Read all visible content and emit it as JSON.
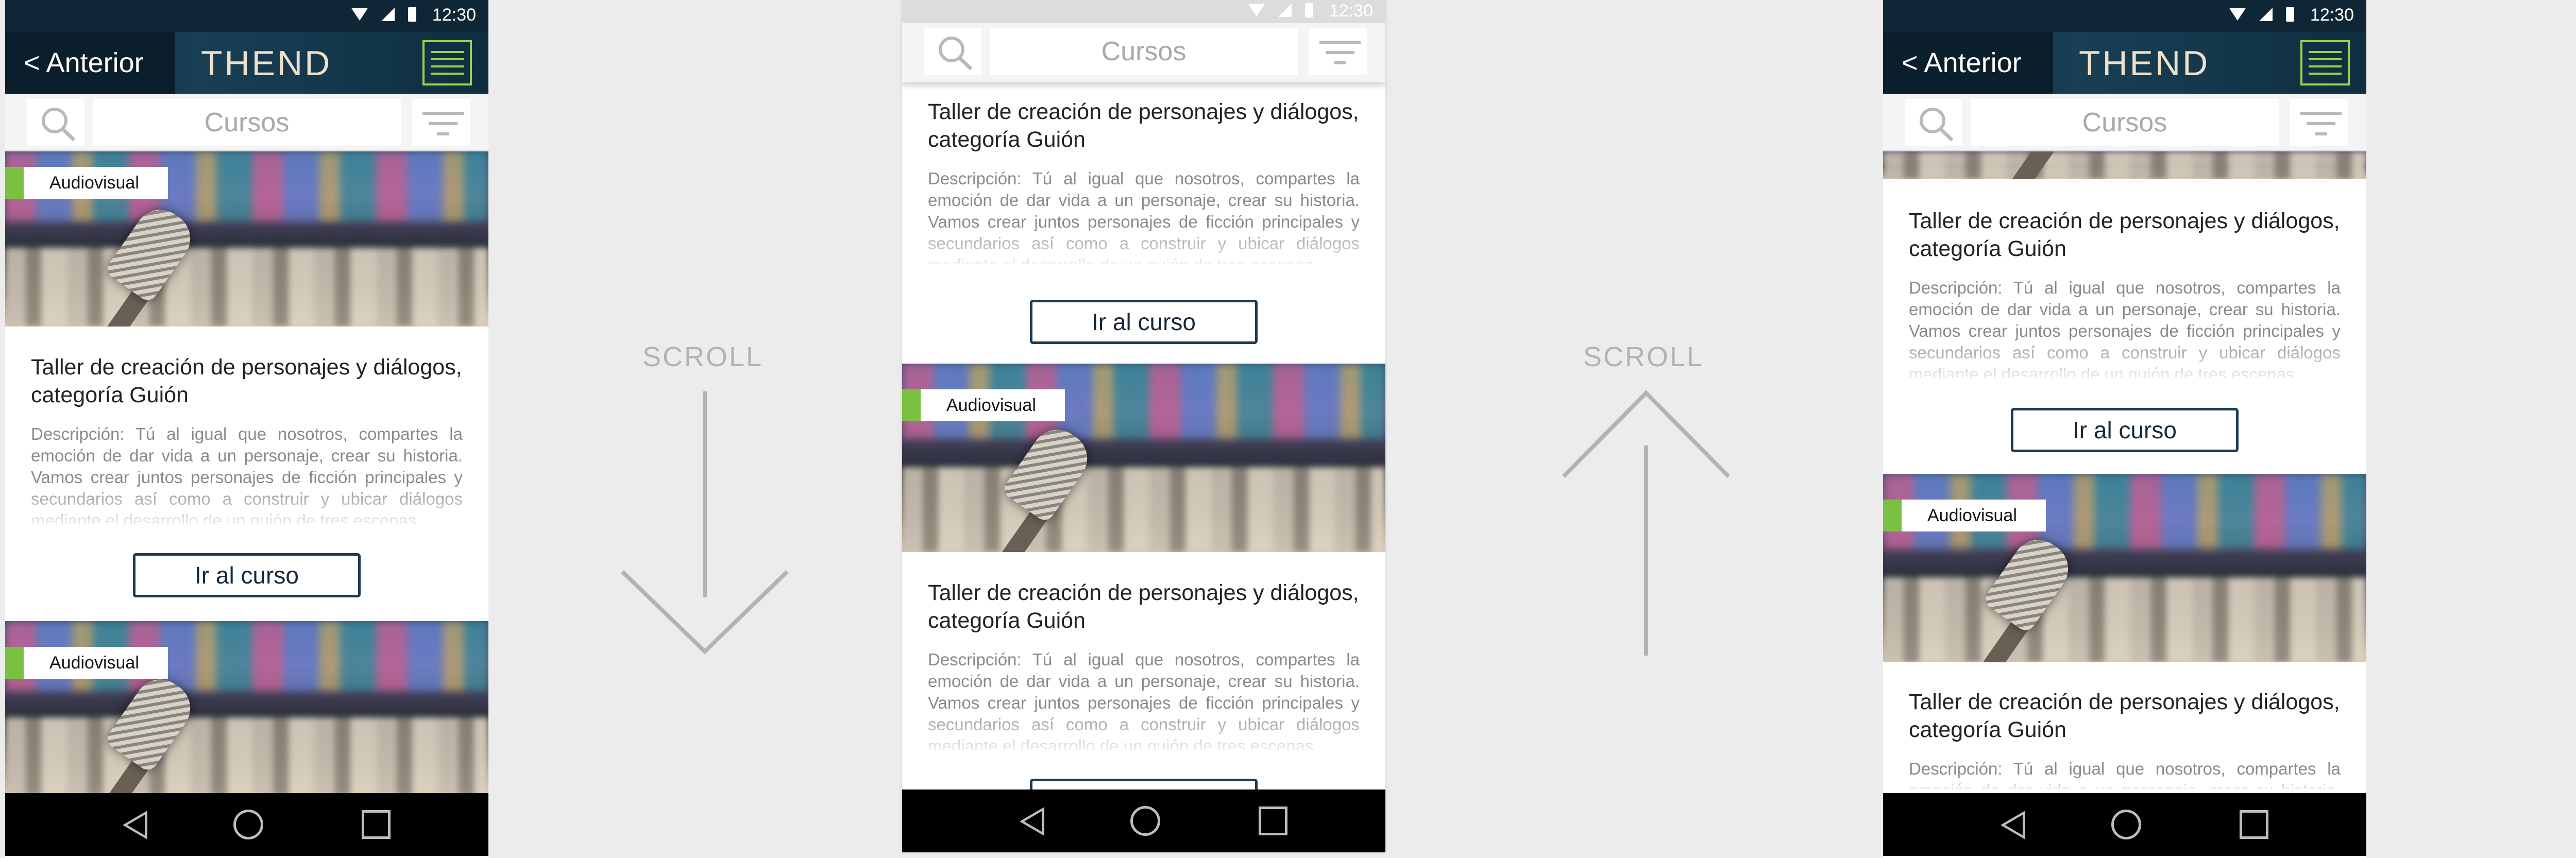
{
  "status": {
    "time": "12:30"
  },
  "nav": {
    "back_label": "< Anterior",
    "logo": "THEND"
  },
  "search": {
    "placeholder": "Cursos"
  },
  "course": {
    "category": "Audiovisual",
    "title": "Taller de creación de personajes y diálogos, categoría Guión",
    "description": "Descripción: Tú al igual que nosotros, compartes la emoción de dar vida a un personaje, crear su historia. Vamos crear juntos personajes de ficción principales y secundarios así como a construir y ubicar diálogos mediante el desarrollo de un guión de tres escenas.",
    "button": "Ir al curso"
  },
  "annotations": {
    "scroll_down": "SCROLL",
    "scroll_up": "SCROLL"
  },
  "colors": {
    "brand_dark": "#0f2636",
    "accent_green": "#7ac142",
    "button_border": "#1c3a55"
  }
}
